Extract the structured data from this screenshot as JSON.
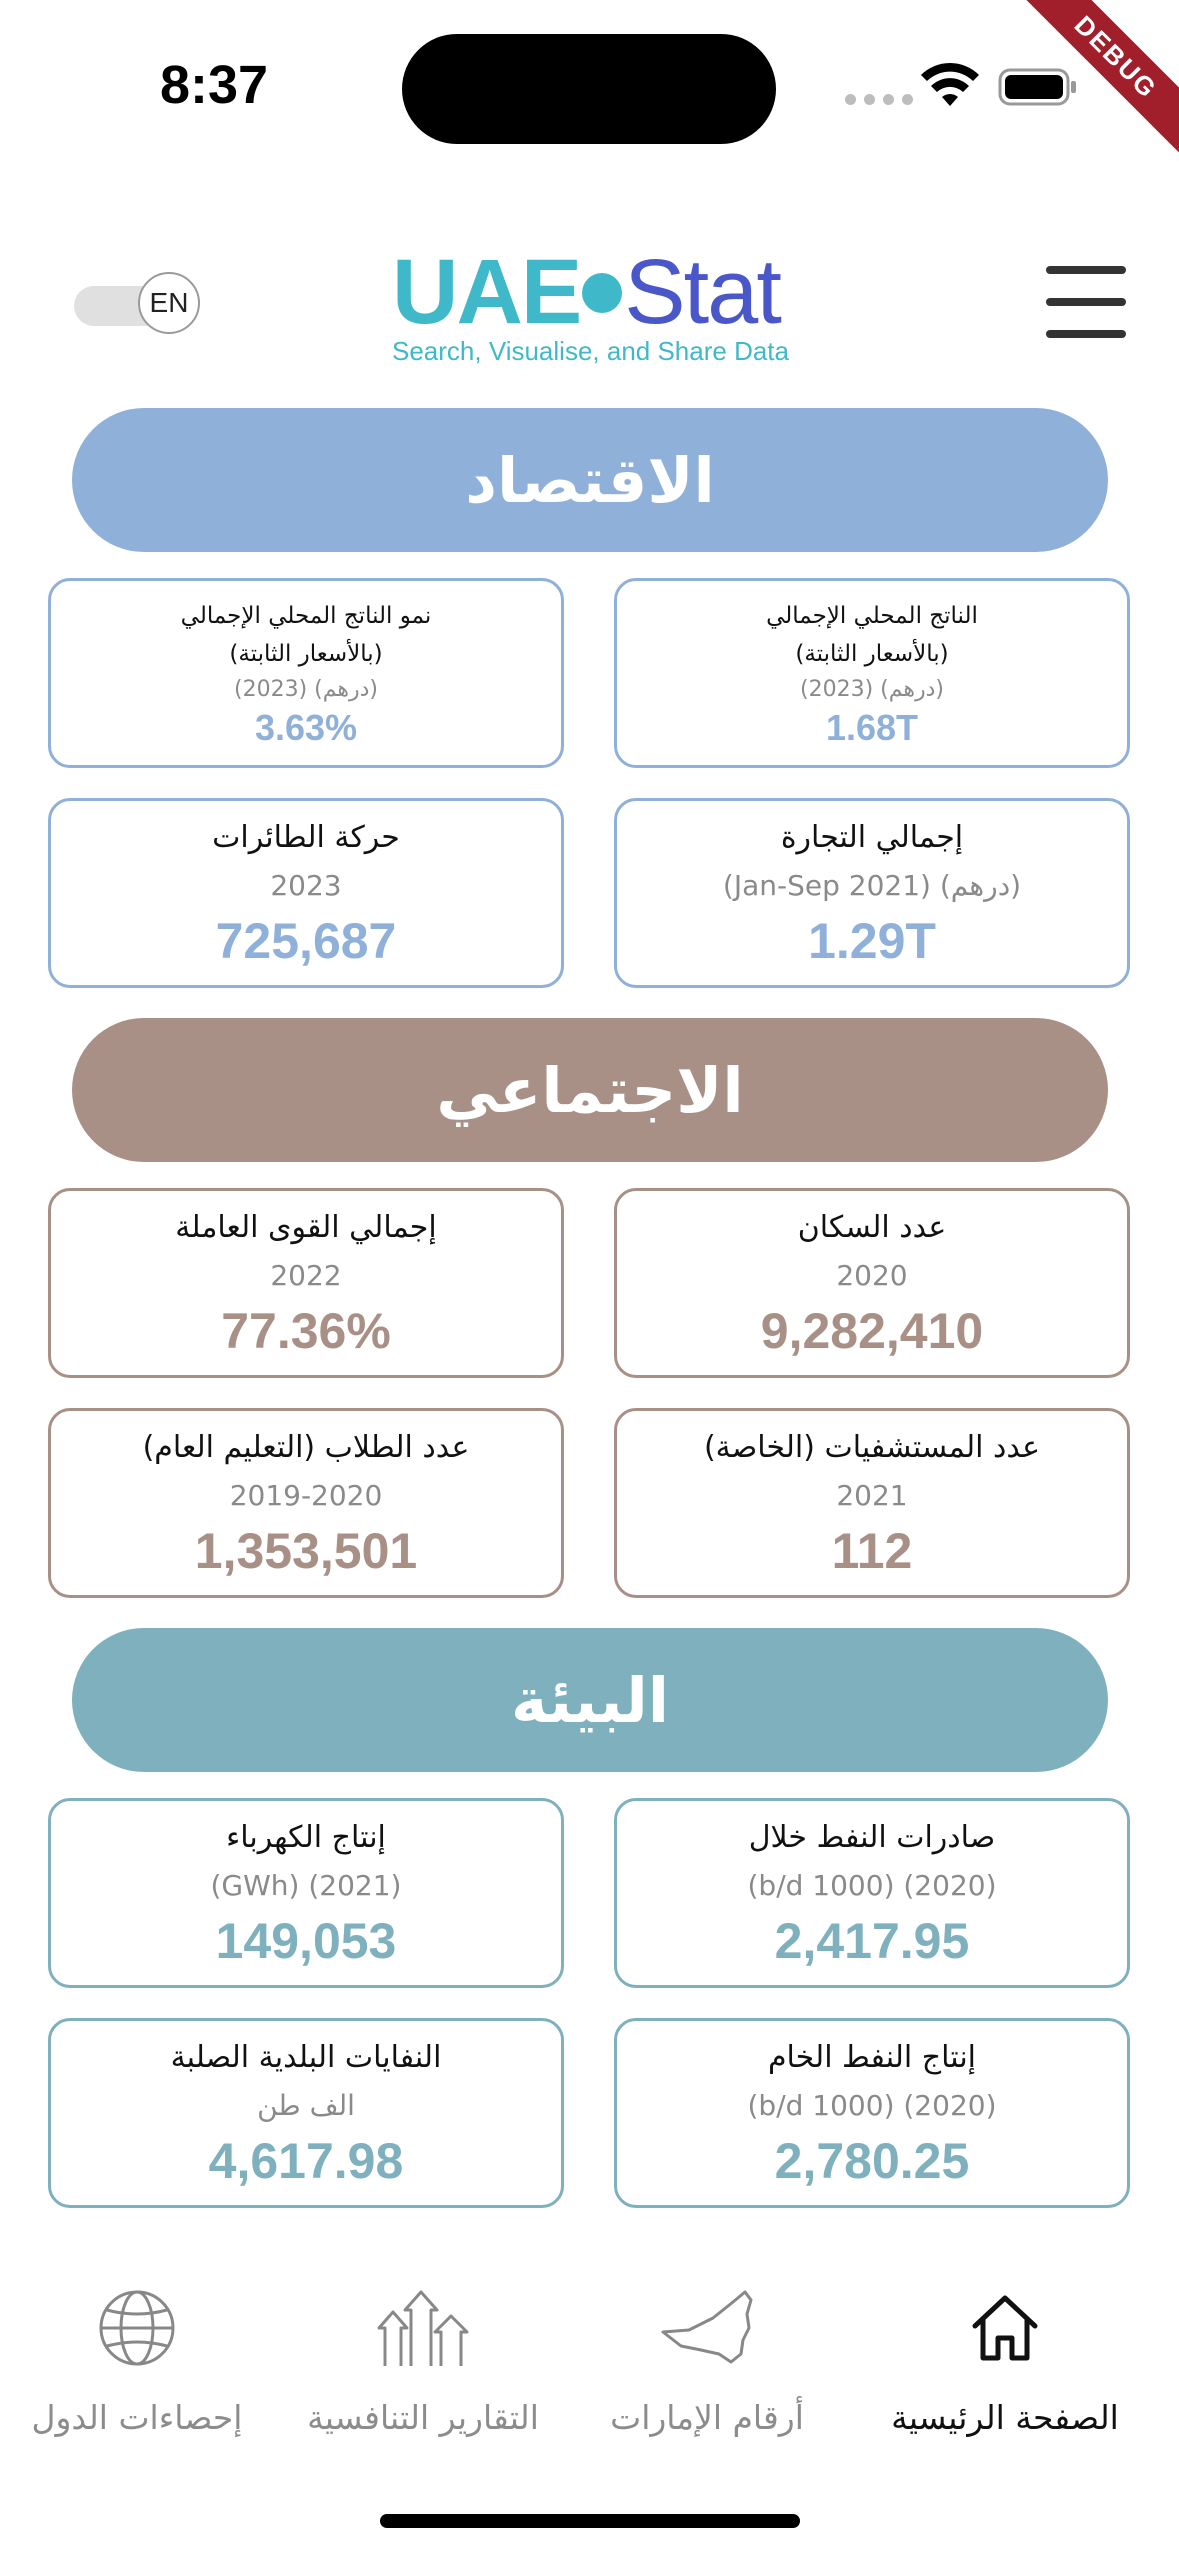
{
  "status_bar": {
    "time": "8:37",
    "debug_label": "DEBUG"
  },
  "header": {
    "lang_toggle_label": "EN",
    "logo": {
      "brand_a": "UAE",
      "brand_b": "Stat",
      "tagline": "Search, Visualise, and Share Data"
    }
  },
  "sections": {
    "economy": {
      "title": "الاقتصاد",
      "color": "#8fb0d8",
      "cards": [
        {
          "title": "الناتج المحلي الإجمالي",
          "title2": "(بالأسعار الثابتة)",
          "subtitle": "(2023) (درهم)",
          "value": "1.68T"
        },
        {
          "title": "نمو الناتج المحلي الإجمالي",
          "title2": "(بالأسعار الثابتة)",
          "subtitle": "(2023) (درهم)",
          "value": "3.63%"
        },
        {
          "title": "إجمالي التجارة",
          "subtitle": "(Jan-Sep 2021) (درهم)",
          "value": "1.29T"
        },
        {
          "title": "حركة الطائرات",
          "subtitle": "2023",
          "value": "725,687"
        }
      ]
    },
    "social": {
      "title": "الاجتماعي",
      "color": "#a99086",
      "cards": [
        {
          "title": "عدد السكان",
          "subtitle": "2020",
          "value": "9,282,410"
        },
        {
          "title": "إجمالي القوى العاملة",
          "subtitle": "2022",
          "value": "77.36%"
        },
        {
          "title": "عدد المستشفيات (الخاصة)",
          "subtitle": "2021",
          "value": "112"
        },
        {
          "title": "عدد الطلاب (التعليم العام)",
          "subtitle": "2019-2020",
          "value": "1,353,501"
        }
      ]
    },
    "environment": {
      "title": "البيئة",
      "color": "#7eb0bd",
      "cards": [
        {
          "title": "صادرات النفط خلال",
          "subtitle": "(b/d 1000) (2020)",
          "value": "2,417.95"
        },
        {
          "title": "إنتاج الكهرباء",
          "subtitle": "(GWh) (2021)",
          "value": "149,053"
        },
        {
          "title": "إنتاج النفط الخام",
          "subtitle": "(b/d 1000) (2020)",
          "value": "2,780.25"
        },
        {
          "title": "النفايات البلدية الصلبة",
          "subtitle": "الف طن",
          "value": "4,617.98"
        }
      ]
    }
  },
  "bottom_nav": {
    "items": [
      {
        "label": "الصفحة الرئيسية",
        "icon": "home-icon",
        "active": true
      },
      {
        "label": "أرقام الإمارات",
        "icon": "uae-map-icon",
        "active": false
      },
      {
        "label": "التقارير التنافسية",
        "icon": "arrows-up-icon",
        "active": false
      },
      {
        "label": "إحصاءات الدول",
        "icon": "globe-icon",
        "active": false
      }
    ]
  }
}
